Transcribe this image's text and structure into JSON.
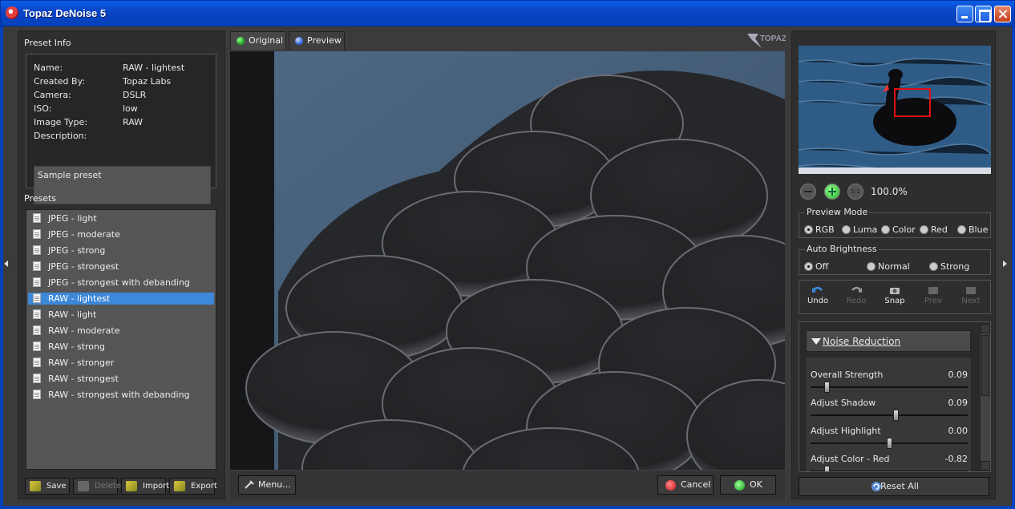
{
  "window": {
    "title": "Topaz DeNoise 5"
  },
  "preset_info": {
    "section_label": "Preset Info",
    "fields": [
      {
        "key": "Name:",
        "value": "RAW - lightest"
      },
      {
        "key": "Created By:",
        "value": "Topaz Labs"
      },
      {
        "key": "Camera:",
        "value": "DSLR"
      },
      {
        "key": "ISO:",
        "value": "low"
      },
      {
        "key": "Image Type:",
        "value": "RAW"
      },
      {
        "key": "Description:",
        "value": ""
      }
    ],
    "description": "Sample preset"
  },
  "presets": {
    "section_label": "Presets",
    "items": [
      {
        "label": "JPEG - light",
        "selected": false
      },
      {
        "label": "JPEG - moderate",
        "selected": false
      },
      {
        "label": "JPEG - strong",
        "selected": false
      },
      {
        "label": "JPEG - strongest",
        "selected": false
      },
      {
        "label": "JPEG - strongest with debanding",
        "selected": false
      },
      {
        "label": "RAW - lightest",
        "selected": true
      },
      {
        "label": "RAW - light",
        "selected": false
      },
      {
        "label": "RAW - moderate",
        "selected": false
      },
      {
        "label": "RAW - strong",
        "selected": false
      },
      {
        "label": "RAW - stronger",
        "selected": false
      },
      {
        "label": "RAW - strongest",
        "selected": false
      },
      {
        "label": "RAW - strongest with debanding",
        "selected": false
      }
    ],
    "buttons": {
      "save": "Save",
      "delete": "Delete",
      "import": "Import",
      "export": "Export"
    }
  },
  "tabs": {
    "original": "Original",
    "preview": "Preview"
  },
  "logo": {
    "text": "TOPAZ"
  },
  "bottom_bar": {
    "menu": "Menu...",
    "cancel": "Cancel",
    "ok": "OK"
  },
  "navigator": {
    "zoom": "100.0%",
    "zoom_fit_icon": "1:1"
  },
  "preview_mode": {
    "title": "Preview Mode",
    "options": [
      "RGB",
      "Luma",
      "Color",
      "Red",
      "Blue"
    ],
    "selected": "RGB"
  },
  "auto_brightness": {
    "title": "Auto Brightness",
    "options": [
      "Off",
      "Normal",
      "Strong"
    ],
    "selected": "Off"
  },
  "history_toolbar": {
    "undo": "Undo",
    "redo": "Redo",
    "snap": "Snap",
    "prev": "Prev",
    "next": "Next"
  },
  "noise_reduction": {
    "title": "Noise Reduction",
    "sliders": [
      {
        "label": "Overall Strength",
        "value": "0.09",
        "fraction": 0.09
      },
      {
        "label": "Adjust Shadow",
        "value": "0.09",
        "fraction": 0.545
      },
      {
        "label": "Adjust Highlight",
        "value": "0.00",
        "fraction": 0.5
      },
      {
        "label": "Adjust Color - Red",
        "value": "-0.82",
        "fraction": 0.09
      }
    ]
  },
  "reset_all": "Reset All",
  "colors": {
    "selection": "#3d88d8",
    "titlebar": "#0a5ee6",
    "panel": "#2e2e2e"
  }
}
